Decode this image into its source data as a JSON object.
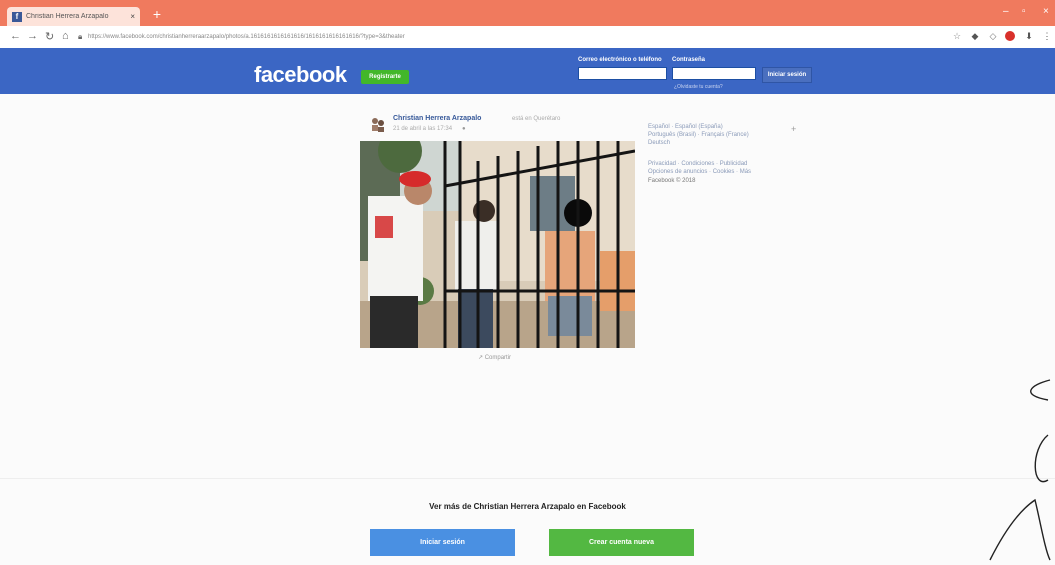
{
  "browser": {
    "tab_title": "Christian Herrera Arzapalo",
    "tab_close": "×",
    "new_tab": "+",
    "url": "https://www.facebook.com/christianherreraarzapalo/photos/a.1616161616161616/1616161616161616/?type=3&theater",
    "win_min": "–",
    "win_max": "▫",
    "win_close": "×"
  },
  "header": {
    "logo": "facebook",
    "register_label": "Registrarte",
    "email_label": "Correo electrónico o teléfono",
    "password_label": "Contraseña",
    "login_label": "Iniciar sesión",
    "forgot_label": "¿Olvidaste tu cuenta?"
  },
  "post": {
    "author": "Christian Herrera Arzapalo",
    "author_meta": "está en Querétaro",
    "date": "21 de abril a las 17:34",
    "share_label": "Compartir"
  },
  "sidebar": {
    "lang_line1": "Español · Español (España)",
    "lang_line2": "Português (Brasil) · Français (France)",
    "lang_line3": "Deutsch",
    "links1": "Privacidad · Condiciones · Publicidad",
    "links2": "Opciones de anuncios · Cookies · Más",
    "copyright": "Facebook © 2018"
  },
  "footer": {
    "ver_mas": "Ver más de Christian Herrera Arzapalo en Facebook",
    "login_button": "Iniciar sesión",
    "create_button": "Crear cuenta nueva"
  },
  "colors": {
    "fb_blue": "#3b66c4",
    "fb_green": "#42b72a",
    "tab_bar": "#f07a5e"
  }
}
